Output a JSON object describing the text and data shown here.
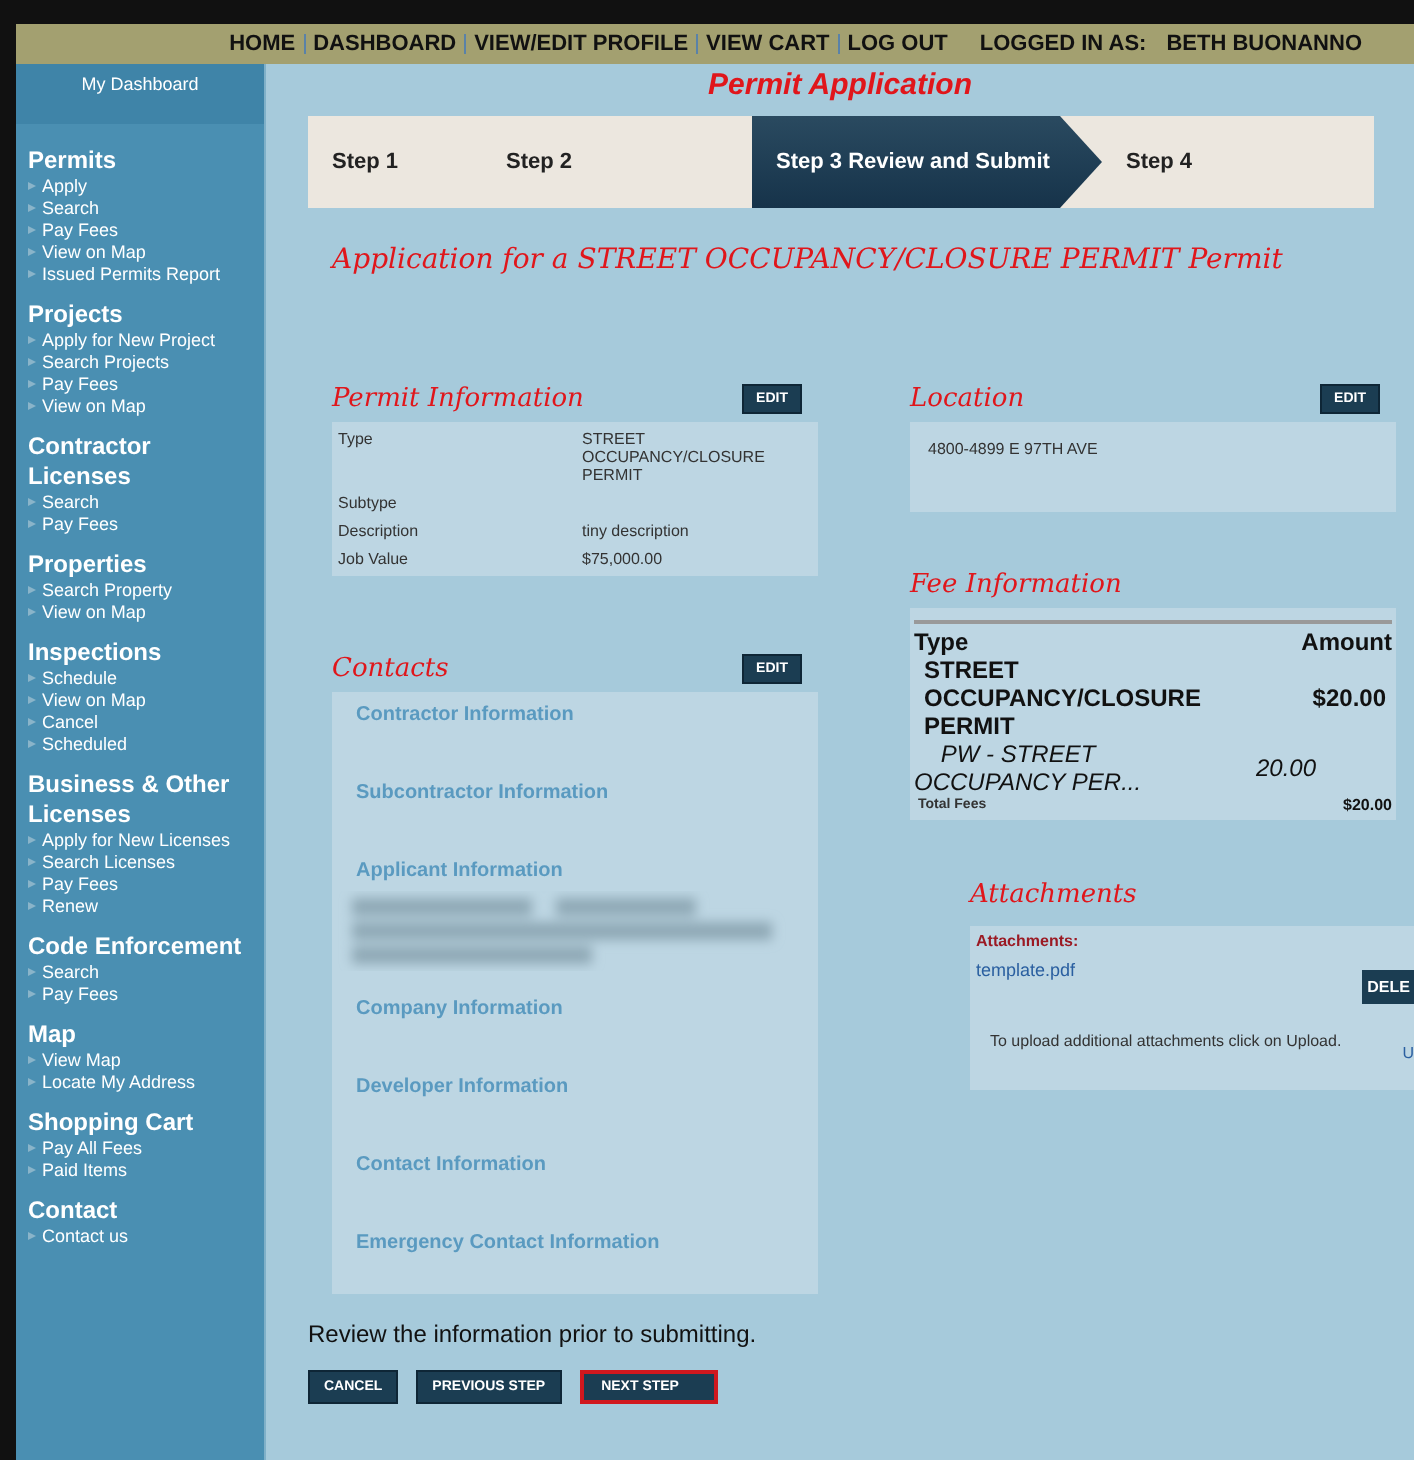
{
  "top_nav": {
    "links": [
      "HOME",
      "DASHBOARD",
      "VIEW/EDIT PROFILE",
      "VIEW CART",
      "LOG OUT"
    ],
    "logged_in_label": "LOGGED IN AS:",
    "user": "BETH BUONANNO"
  },
  "sidebar": {
    "dashboard": "My Dashboard",
    "sections": [
      {
        "title": "Permits",
        "items": [
          "Apply",
          "Search",
          "Pay Fees",
          "View on Map",
          "Issued Permits Report"
        ]
      },
      {
        "title": "Projects",
        "items": [
          "Apply for New Project",
          "Search Projects",
          "Pay Fees",
          "View on Map"
        ]
      },
      {
        "title": "Contractor Licenses",
        "items": [
          "Search",
          "Pay Fees"
        ]
      },
      {
        "title": "Properties",
        "items": [
          "Search Property",
          "View on Map"
        ]
      },
      {
        "title": "Inspections",
        "items": [
          "Schedule",
          "View on Map",
          "Cancel",
          "Scheduled"
        ]
      },
      {
        "title": "Business & Other Licenses",
        "items": [
          "Apply for New Licenses",
          "Search Licenses",
          "Pay Fees",
          "Renew"
        ]
      },
      {
        "title": "Code Enforcement",
        "items": [
          "Search",
          "Pay Fees"
        ]
      },
      {
        "title": "Map",
        "items": [
          "View Map",
          "Locate My Address"
        ]
      },
      {
        "title": "Shopping Cart",
        "items": [
          "Pay All Fees",
          "Paid Items"
        ]
      },
      {
        "title": "Contact",
        "items": [
          "Contact us"
        ]
      }
    ]
  },
  "page_title": "Permit Application",
  "steps": [
    {
      "label": "Step 1",
      "selected": false
    },
    {
      "label": "Step 2",
      "selected": false
    },
    {
      "label": "Step 3",
      "sublabel": "Review and Submit",
      "selected": true
    },
    {
      "label": "Step 4",
      "selected": false
    }
  ],
  "application_heading": "Application for a STREET OCCUPANCY/CLOSURE PERMIT Permit",
  "permit_information": {
    "title": "Permit Information",
    "edit": "EDIT",
    "rows": [
      {
        "label": "Type",
        "value": "STREET OCCUPANCY/CLOSURE PERMIT"
      },
      {
        "label": "Subtype"
      },
      {
        "label": "Description",
        "value": "tiny description"
      },
      {
        "label": "Job Value",
        "value": "$75,000.00"
      }
    ]
  },
  "contacts": {
    "title": "Contacts",
    "edit": "EDIT",
    "items": [
      {
        "label": "Contractor Information"
      },
      {
        "label": "Subcontractor Information"
      },
      {
        "label": "Applicant Information",
        "redacted": true
      },
      {
        "label": "Company Information"
      },
      {
        "label": "Developer Information"
      },
      {
        "label": "Contact Information"
      },
      {
        "label": "Emergency Contact Information"
      }
    ]
  },
  "location": {
    "title": "Location",
    "edit": "EDIT",
    "address": "4800-4899 E 97TH AVE"
  },
  "fee_information": {
    "title": "Fee Information",
    "columns": [
      "Type",
      "Amount"
    ],
    "fee": {
      "type": "STREET OCCUPANCY/CLOSURE PERMIT",
      "amount": "$20.00"
    },
    "line": {
      "type": "PW - STREET OCCUPANCY PER...",
      "amount": "20.00"
    },
    "total_label": "Total Fees",
    "total": "$20.00"
  },
  "attachments": {
    "title": "Attachments",
    "label": "Attachments:",
    "files": [
      "template.pdf"
    ],
    "delete": "DELE",
    "note": "To upload additional attachments click on Upload.",
    "upload": "U"
  },
  "review_note": "Review the information prior to submitting.",
  "buttons": [
    {
      "label": "CANCEL",
      "selected": false
    },
    {
      "label": "PREVIOUS STEP",
      "selected": false
    },
    {
      "label": "NEXT STEP",
      "selected": true
    }
  ]
}
